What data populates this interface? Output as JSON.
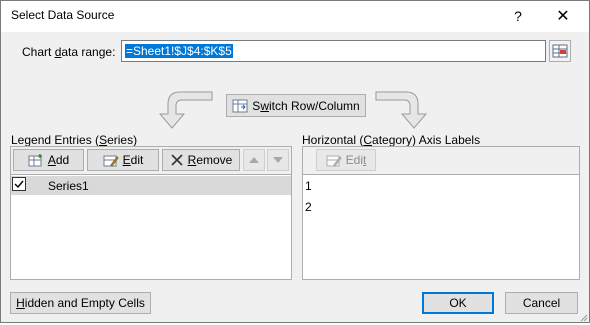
{
  "dialog": {
    "title": "Select Data Source",
    "help": "?",
    "close": "✕"
  },
  "chart_range": {
    "label_pre": "Chart ",
    "label_u": "d",
    "label_post": "ata range:",
    "value": "=Sheet1!$J$4:$K$5"
  },
  "switch": {
    "label_pre": "S",
    "label_u": "w",
    "label_post": "itch Row/Column"
  },
  "legend": {
    "title_pre": "Legend Entries (",
    "title_u": "S",
    "title_post": "eries)",
    "add_u": "A",
    "add_post": "dd",
    "edit_u": "E",
    "edit_post": "dit",
    "remove_u": "R",
    "remove_post": "emove",
    "series": [
      {
        "label": "Series1",
        "checked": true
      }
    ]
  },
  "axis": {
    "title_pre": "Horizontal (",
    "title_u": "C",
    "title_post": "ategory) Axis Labels",
    "edit_pre": "Edi",
    "edit_u": "t",
    "items": [
      "1",
      "2"
    ]
  },
  "footer": {
    "hidden_u": "H",
    "hidden_post": "idden and Empty Cells",
    "ok": "OK",
    "cancel": "Cancel"
  },
  "colors": {
    "selection": "#0078d7",
    "row_selected": "#d9d9d9",
    "dialog_bg": "#f0f0f0"
  }
}
